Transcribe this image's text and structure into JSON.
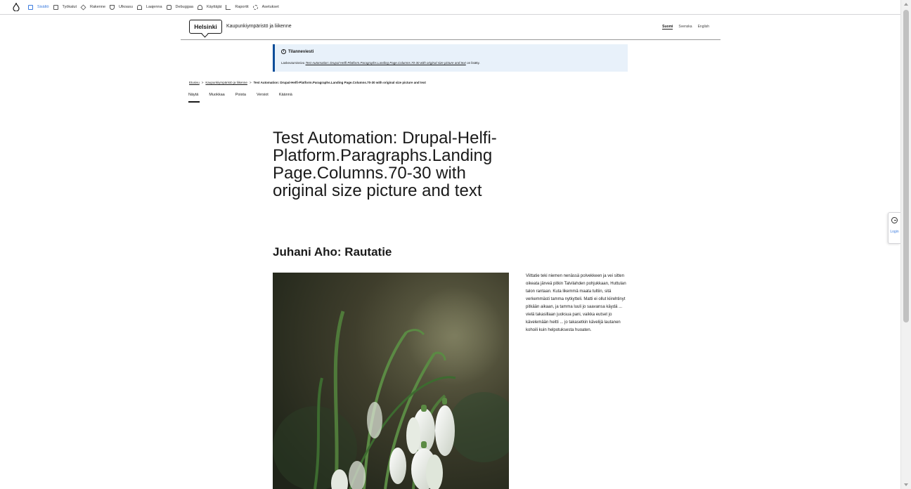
{
  "toolbar": {
    "items": [
      {
        "label": "Sisältö",
        "icon": "content-icon"
      },
      {
        "label": "Työkalut",
        "icon": "tools-icon"
      },
      {
        "label": "Rakenne",
        "icon": "structure-icon"
      },
      {
        "label": "Ulkoasu",
        "icon": "appearance-icon"
      },
      {
        "label": "Laajenna",
        "icon": "extend-icon"
      },
      {
        "label": "Debuggaa",
        "icon": "debug-icon"
      },
      {
        "label": "Käyttäjät",
        "icon": "users-icon"
      },
      {
        "label": "Raportit",
        "icon": "reports-icon"
      },
      {
        "label": "Asetukset",
        "icon": "settings-icon"
      }
    ]
  },
  "side": {
    "login_label": "Login"
  },
  "header": {
    "logo_text": "Helsinki",
    "site_name": "Kaupunkiympäristö ja liikenne",
    "languages": [
      "Suomi",
      "Svenska",
      "English"
    ]
  },
  "status": {
    "title": "Tilanneviesti",
    "message_prefix": "Laskeutumissivu ",
    "message_link": "Test Automation: Drupal-Helfi-Platform.Paragraphs.Landing Page.Columns.70-30 with original size picture and text",
    "message_suffix": " on lisätty."
  },
  "breadcrumb": {
    "home": "Etusivu",
    "sep": ">",
    "parent": "Kaupunkiympäristö ja liikenne",
    "current": "Test Automation: Drupal-Helfi-Platform.Paragraphs.Landing Page.Columns.70-30 with original size picture and text"
  },
  "tabs": [
    "Näytä",
    "Muokkaa",
    "Poista",
    "Versiot",
    "Käännä"
  ],
  "content": {
    "title": "Test Automation: Drupal-Helfi-Platform.Paragraphs.Landing Page.Columns.70-30 with original size picture and text",
    "subtitle": "Juhani Aho: Rautatie",
    "body": "Viittatie teki niemen nenässä polvekkeen ja vei sitten oikeata järveä pitkin Talvilahden pohjukkaan, Huttulan talon rantaan. Kuta likemmä maata tultiin, sitä verkemmästi tamma nytkytteli. Matti ei ollut kiirehtinyt pitkään aikaan, ja tamma luuli jo saavansa käydä ... vielä takasillaan juoksua pani, vaikka eutset jo kävelemään heitti ... jo takasetkin kävelijä lautanen kohoili kuin helpotuksesta huoaten."
  },
  "colors": {
    "accent": "#3b7bde",
    "status_bg": "#e8f1fa",
    "status_border": "#0a4d99"
  }
}
